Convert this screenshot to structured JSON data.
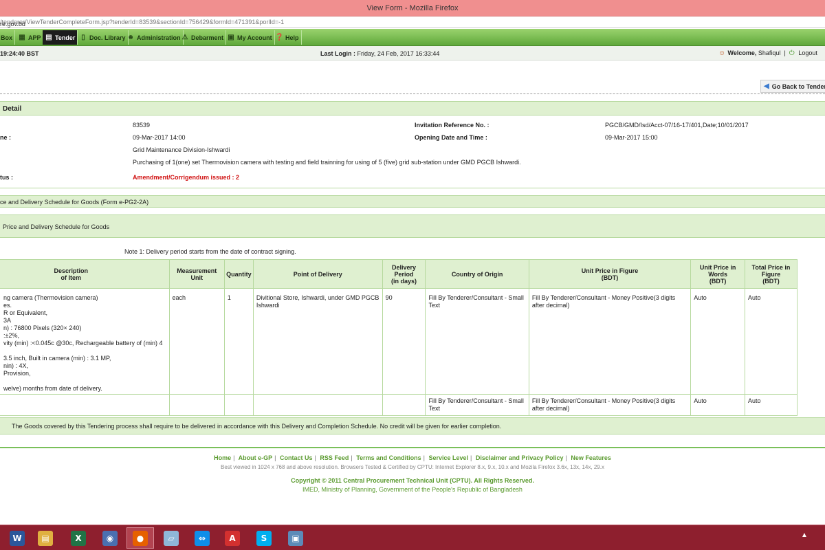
{
  "window": {
    "title": "View Form - Mozilla Firefox",
    "url_host": "re.gov.bd",
    "url_path": "/tenderer/ViewTenderCompleteForm.jsp?tenderId=83539&sectionId=756429&formId=471391&porlId=-1"
  },
  "menu": {
    "items": [
      {
        "label": "Box",
        "icon": "message-box-icon"
      },
      {
        "label": "APP",
        "icon": "app-grid-icon"
      },
      {
        "label": "Tender",
        "icon": "tender-icon",
        "active": true
      },
      {
        "label": "Doc. Library",
        "icon": "document-icon"
      },
      {
        "label": "Administration",
        "icon": "admin-user-icon"
      },
      {
        "label": "Debarment",
        "icon": "debarment-icon"
      },
      {
        "label": "My Account",
        "icon": "account-icon"
      },
      {
        "label": "Help",
        "icon": "help-icon"
      }
    ]
  },
  "infobar": {
    "time": "19:24:40 BST",
    "last_login_label": "Last Login :",
    "last_login_value": "Friday, 24 Feb, 2017 16:33:44",
    "welcome_label": "Welcome,",
    "user_name": "Shafiqul",
    "separator": "|",
    "logout": "Logout"
  },
  "back_button": "Go Back to Tender",
  "detail": {
    "header": "Detail",
    "tender_id": "83539",
    "closing_label": "ne :",
    "closing_value": "09-Mar-2017 14:00",
    "office": "Grid Maintenance Division-Ishwardi",
    "brief": "Purchasing of 1(one) set Thermovision camera with testing and field trainning for using of 5 (five) grid sub-station under GMD PGCB Ishwardi.",
    "status_label": "tus :",
    "status_value": "Amendment/Corrigendum issued : 2",
    "invitation_ref_label": "Invitation Reference No. :",
    "invitation_ref_value": "PGCB/GMD/Isd/Acct-07/16-17/401,Date;10/01/2017",
    "opening_label": "Opening Date and Time :",
    "opening_value": "09-Mar-2017 15:00"
  },
  "form_header": "ce and Delivery Schedule for Goods (Form e-PG2-2A)",
  "schedule_header": "Price and Delivery Schedule for Goods",
  "note": "Note 1: Delivery period starts from the date of contract signing.",
  "table": {
    "headers": {
      "description": "Description\nof Item",
      "measurement": "Measurement\nUnit",
      "quantity": "Quantity",
      "point": "Point of Delivery",
      "period": "Delivery\nPeriod\n(in days)",
      "country": "Country of Origin",
      "unit_price_fig": "Unit Price in Figure\n(BDT)",
      "unit_price_words": "Unit Price in\nWords\n(BDT)",
      "total_price": "Total Price in\nFigure\n(BDT)"
    },
    "row1": {
      "description_lines": [
        "ng camera (Thermovision camera)",
        "es.",
        "R or Equivalent,",
        "3A",
        "n) : 76800 Pixels (320× 240)",
        ":±2%,",
        "vity (min) :<0.045c @30c, Rechargeable battery of (min) 4",
        "",
        "3.5 inch, Built in camera (min) : 3.1 MP,",
        "nin) : 4X,",
        "Provision,",
        "",
        "welve) months from date of delivery."
      ],
      "measurement": "each",
      "quantity": "1",
      "point": "Divitional Store, Ishwardi, under GMD PGCB Ishwardi",
      "period": "90",
      "country": "Fill By Tenderer/Consultant - Small Text",
      "unit_price_fig": "Fill By Tenderer/Consultant - Money Positive(3 digits after decimal)",
      "unit_price_words": "Auto",
      "total_price": "Auto"
    },
    "row2": {
      "country": "Fill By Tenderer/Consultant - Small Text",
      "unit_price_fig": "Fill By Tenderer/Consultant - Money Positive(3 digits after decimal)",
      "unit_price_words": "Auto",
      "total_price": "Auto"
    }
  },
  "goods_note": "The Goods covered by this Tendering process shall require to be delivered in accordance with this Delivery and Completion Schedule. No credit will be given for earlier completion.",
  "footer": {
    "links": [
      "Home",
      "About e-GP",
      "Contact Us",
      "RSS Feed",
      "Terms and Conditions",
      "Service Level",
      "Disclaimer and Privacy Policy",
      "New Features"
    ],
    "note": "Best viewed in 1024 x 768 and above resolution. Browsers Tested & Certified by CPTU: Internet Explorer 8.x, 9.x, 10.x and Mozila Firefox 3.6x, 13x, 14x, 29.x",
    "copyright": "Copyright © 2011 Central Procurement Technical Unit (CPTU). All Rights Reserved.",
    "org": "IMED, Ministry of Planning, Government of the People's Republic of Bangladesh"
  },
  "taskbar": {
    "apps": [
      {
        "name": "word-icon",
        "glyph": "W",
        "color": "#2b579a"
      },
      {
        "name": "file-explorer-icon",
        "glyph": "▤",
        "color": "#e0b040"
      },
      {
        "name": "excel-icon",
        "glyph": "X",
        "color": "#217346"
      },
      {
        "name": "outlook-icon",
        "glyph": "◉",
        "color": "#4a6fb0"
      },
      {
        "name": "firefox-icon",
        "glyph": "●",
        "color": "#e66000",
        "active": true
      },
      {
        "name": "notes-icon",
        "glyph": "▱",
        "color": "#8fb7d8"
      },
      {
        "name": "teamviewer-icon",
        "glyph": "⇔",
        "color": "#0e8ee9"
      },
      {
        "name": "acrobat-icon",
        "glyph": "A",
        "color": "#d3302f"
      },
      {
        "name": "skype-icon",
        "glyph": "S",
        "color": "#00aff0"
      },
      {
        "name": "photos-icon",
        "glyph": "▣",
        "color": "#5c8bb8"
      }
    ],
    "tray_glyph": "▲"
  }
}
